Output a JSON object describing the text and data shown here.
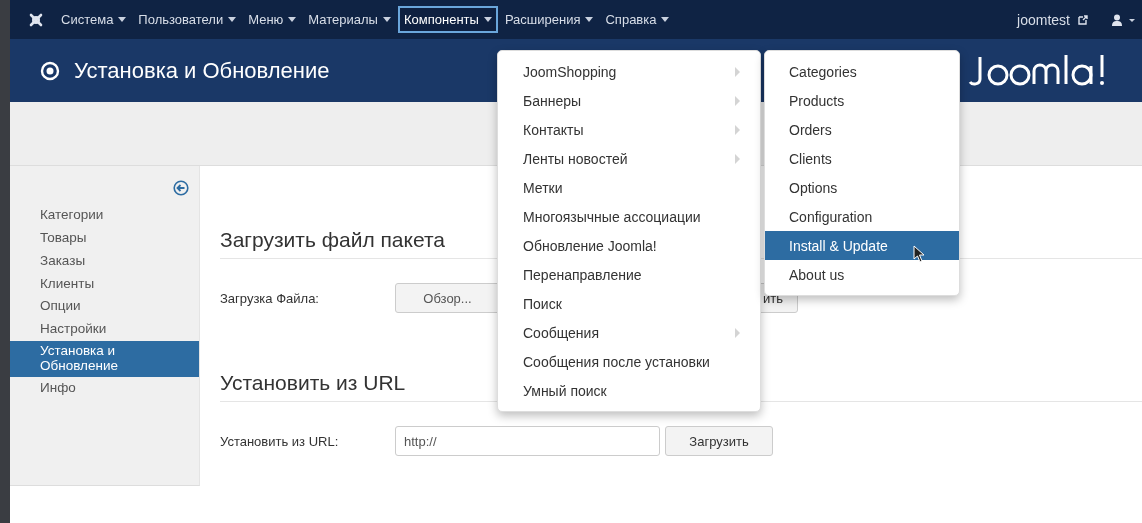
{
  "navbar": {
    "menus": [
      {
        "label": "Система",
        "selected": false
      },
      {
        "label": "Пользователи",
        "selected": false
      },
      {
        "label": "Меню",
        "selected": false
      },
      {
        "label": "Материалы",
        "selected": false
      },
      {
        "label": "Компоненты",
        "selected": true
      },
      {
        "label": "Расширения",
        "selected": false
      },
      {
        "label": "Справка",
        "selected": false
      }
    ],
    "site_link": "joomtest"
  },
  "header": {
    "title": "Установка и Обновление"
  },
  "sidebar": {
    "items": [
      {
        "label": "Категории",
        "selected": false
      },
      {
        "label": "Товары",
        "selected": false
      },
      {
        "label": "Заказы",
        "selected": false
      },
      {
        "label": "Клиенты",
        "selected": false
      },
      {
        "label": "Опции",
        "selected": false
      },
      {
        "label": "Настройки",
        "selected": false
      },
      {
        "label": "Установка и Обновление",
        "selected": true
      },
      {
        "label": "Инфо",
        "selected": false
      }
    ]
  },
  "upload": {
    "heading": "Загрузить файл пакета",
    "label": "Загрузка Файла:",
    "browse_button": "Обзор...",
    "upload_button": "ить"
  },
  "url_install": {
    "heading": "Установить из URL",
    "label": "Установить из URL:",
    "value": "http://",
    "button": "Загрузить"
  },
  "components_menu": {
    "items": [
      {
        "label": "JoomShopping",
        "submenu": true
      },
      {
        "label": "Баннеры",
        "submenu": true
      },
      {
        "label": "Контакты",
        "submenu": true
      },
      {
        "label": "Ленты новостей",
        "submenu": true
      },
      {
        "label": "Метки",
        "submenu": false
      },
      {
        "label": "Многоязычные ассоциации",
        "submenu": false
      },
      {
        "label": "Обновление Joomla!",
        "submenu": false
      },
      {
        "label": "Перенаправление",
        "submenu": false
      },
      {
        "label": "Поиск",
        "submenu": false
      },
      {
        "label": "Сообщения",
        "submenu": true
      },
      {
        "label": "Сообщения после установки",
        "submenu": false
      },
      {
        "label": "Умный поиск",
        "submenu": false
      }
    ]
  },
  "joomshopping_menu": {
    "items": [
      {
        "label": "Categories",
        "selected": false
      },
      {
        "label": "Products",
        "selected": false
      },
      {
        "label": "Orders",
        "selected": false
      },
      {
        "label": "Clients",
        "selected": false
      },
      {
        "label": "Options",
        "selected": false
      },
      {
        "label": "Configuration",
        "selected": false
      },
      {
        "label": "Install & Update",
        "selected": true
      },
      {
        "label": "About us",
        "selected": false
      }
    ]
  }
}
